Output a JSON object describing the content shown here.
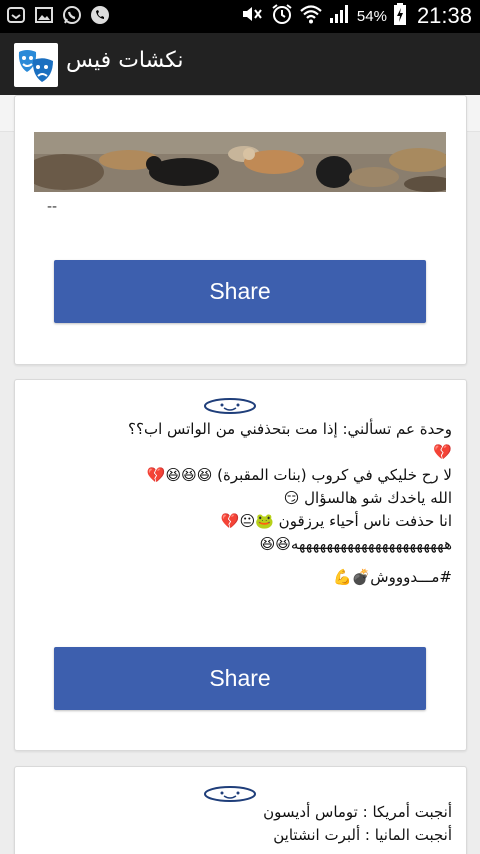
{
  "status_bar": {
    "battery_percent": "54%",
    "time": "21:38",
    "left_icons": [
      "voicemail-icon",
      "image-icon",
      "whatsapp-icon",
      "phone-icon"
    ],
    "right_icons": [
      "mute-icon",
      "alarm-icon",
      "wifi-icon",
      "signal-icon",
      "battery-icon"
    ]
  },
  "app_bar": {
    "title": "نكشات فيس",
    "icon": "theater-masks-icon"
  },
  "posts": [
    {
      "image": "dogs-photo",
      "text_tail": "--",
      "share_label": "Share"
    },
    {
      "lines": [
        "وحدة عم تسألني: إذا مت بتحذفني من الواتس اب؟؟",
        "💔",
        "لا رح خليكي في كروب (بنات المقبرة) 😆😆😆💔",
        "الله ياخدك شو هالسؤال 😏",
        "انا حذفت ناس أحياء يرزقون 🐸😐💔",
        "ههههههههههههههههههههههه😆😆"
      ],
      "hashtag": "#مـــدوووش💣💪",
      "share_label": "Share"
    },
    {
      "lines": [
        "أنجبت أمريكا : توماس أديسون",
        "أنجبت المانيا : ألبرت انشتاين"
      ]
    }
  ],
  "colors": {
    "status_bar": "#000000",
    "app_bar": "#222222",
    "share_button": "#3d5fae",
    "background": "#ededed"
  }
}
